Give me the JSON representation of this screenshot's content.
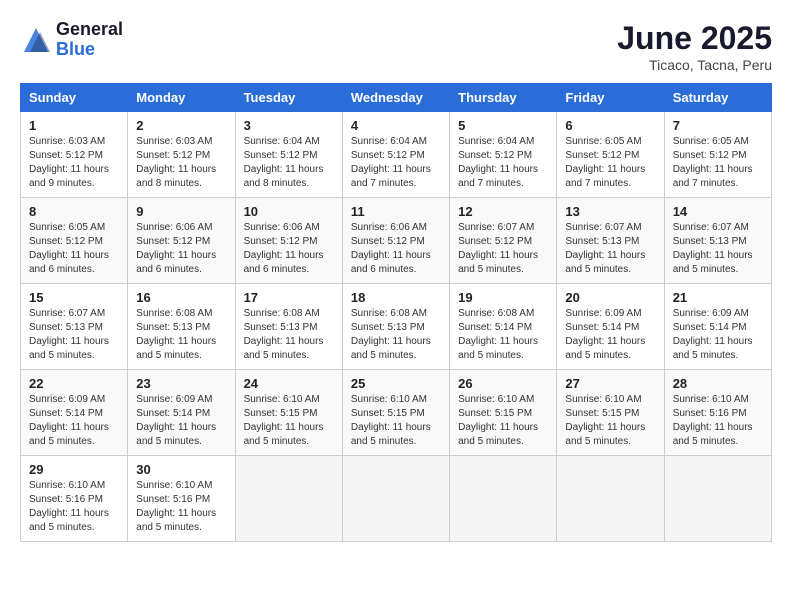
{
  "logo": {
    "general": "General",
    "blue": "Blue"
  },
  "title": "June 2025",
  "location": "Ticaco, Tacna, Peru",
  "weekdays": [
    "Sunday",
    "Monday",
    "Tuesday",
    "Wednesday",
    "Thursday",
    "Friday",
    "Saturday"
  ],
  "weeks": [
    [
      {
        "day": "1",
        "sunrise": "Sunrise: 6:03 AM",
        "sunset": "Sunset: 5:12 PM",
        "daylight": "Daylight: 11 hours and 9 minutes."
      },
      {
        "day": "2",
        "sunrise": "Sunrise: 6:03 AM",
        "sunset": "Sunset: 5:12 PM",
        "daylight": "Daylight: 11 hours and 8 minutes."
      },
      {
        "day": "3",
        "sunrise": "Sunrise: 6:04 AM",
        "sunset": "Sunset: 5:12 PM",
        "daylight": "Daylight: 11 hours and 8 minutes."
      },
      {
        "day": "4",
        "sunrise": "Sunrise: 6:04 AM",
        "sunset": "Sunset: 5:12 PM",
        "daylight": "Daylight: 11 hours and 7 minutes."
      },
      {
        "day": "5",
        "sunrise": "Sunrise: 6:04 AM",
        "sunset": "Sunset: 5:12 PM",
        "daylight": "Daylight: 11 hours and 7 minutes."
      },
      {
        "day": "6",
        "sunrise": "Sunrise: 6:05 AM",
        "sunset": "Sunset: 5:12 PM",
        "daylight": "Daylight: 11 hours and 7 minutes."
      },
      {
        "day": "7",
        "sunrise": "Sunrise: 6:05 AM",
        "sunset": "Sunset: 5:12 PM",
        "daylight": "Daylight: 11 hours and 7 minutes."
      }
    ],
    [
      {
        "day": "8",
        "sunrise": "Sunrise: 6:05 AM",
        "sunset": "Sunset: 5:12 PM",
        "daylight": "Daylight: 11 hours and 6 minutes."
      },
      {
        "day": "9",
        "sunrise": "Sunrise: 6:06 AM",
        "sunset": "Sunset: 5:12 PM",
        "daylight": "Daylight: 11 hours and 6 minutes."
      },
      {
        "day": "10",
        "sunrise": "Sunrise: 6:06 AM",
        "sunset": "Sunset: 5:12 PM",
        "daylight": "Daylight: 11 hours and 6 minutes."
      },
      {
        "day": "11",
        "sunrise": "Sunrise: 6:06 AM",
        "sunset": "Sunset: 5:12 PM",
        "daylight": "Daylight: 11 hours and 6 minutes."
      },
      {
        "day": "12",
        "sunrise": "Sunrise: 6:07 AM",
        "sunset": "Sunset: 5:12 PM",
        "daylight": "Daylight: 11 hours and 5 minutes."
      },
      {
        "day": "13",
        "sunrise": "Sunrise: 6:07 AM",
        "sunset": "Sunset: 5:13 PM",
        "daylight": "Daylight: 11 hours and 5 minutes."
      },
      {
        "day": "14",
        "sunrise": "Sunrise: 6:07 AM",
        "sunset": "Sunset: 5:13 PM",
        "daylight": "Daylight: 11 hours and 5 minutes."
      }
    ],
    [
      {
        "day": "15",
        "sunrise": "Sunrise: 6:07 AM",
        "sunset": "Sunset: 5:13 PM",
        "daylight": "Daylight: 11 hours and 5 minutes."
      },
      {
        "day": "16",
        "sunrise": "Sunrise: 6:08 AM",
        "sunset": "Sunset: 5:13 PM",
        "daylight": "Daylight: 11 hours and 5 minutes."
      },
      {
        "day": "17",
        "sunrise": "Sunrise: 6:08 AM",
        "sunset": "Sunset: 5:13 PM",
        "daylight": "Daylight: 11 hours and 5 minutes."
      },
      {
        "day": "18",
        "sunrise": "Sunrise: 6:08 AM",
        "sunset": "Sunset: 5:13 PM",
        "daylight": "Daylight: 11 hours and 5 minutes."
      },
      {
        "day": "19",
        "sunrise": "Sunrise: 6:08 AM",
        "sunset": "Sunset: 5:14 PM",
        "daylight": "Daylight: 11 hours and 5 minutes."
      },
      {
        "day": "20",
        "sunrise": "Sunrise: 6:09 AM",
        "sunset": "Sunset: 5:14 PM",
        "daylight": "Daylight: 11 hours and 5 minutes."
      },
      {
        "day": "21",
        "sunrise": "Sunrise: 6:09 AM",
        "sunset": "Sunset: 5:14 PM",
        "daylight": "Daylight: 11 hours and 5 minutes."
      }
    ],
    [
      {
        "day": "22",
        "sunrise": "Sunrise: 6:09 AM",
        "sunset": "Sunset: 5:14 PM",
        "daylight": "Daylight: 11 hours and 5 minutes."
      },
      {
        "day": "23",
        "sunrise": "Sunrise: 6:09 AM",
        "sunset": "Sunset: 5:14 PM",
        "daylight": "Daylight: 11 hours and 5 minutes."
      },
      {
        "day": "24",
        "sunrise": "Sunrise: 6:10 AM",
        "sunset": "Sunset: 5:15 PM",
        "daylight": "Daylight: 11 hours and 5 minutes."
      },
      {
        "day": "25",
        "sunrise": "Sunrise: 6:10 AM",
        "sunset": "Sunset: 5:15 PM",
        "daylight": "Daylight: 11 hours and 5 minutes."
      },
      {
        "day": "26",
        "sunrise": "Sunrise: 6:10 AM",
        "sunset": "Sunset: 5:15 PM",
        "daylight": "Daylight: 11 hours and 5 minutes."
      },
      {
        "day": "27",
        "sunrise": "Sunrise: 6:10 AM",
        "sunset": "Sunset: 5:15 PM",
        "daylight": "Daylight: 11 hours and 5 minutes."
      },
      {
        "day": "28",
        "sunrise": "Sunrise: 6:10 AM",
        "sunset": "Sunset: 5:16 PM",
        "daylight": "Daylight: 11 hours and 5 minutes."
      }
    ],
    [
      {
        "day": "29",
        "sunrise": "Sunrise: 6:10 AM",
        "sunset": "Sunset: 5:16 PM",
        "daylight": "Daylight: 11 hours and 5 minutes."
      },
      {
        "day": "30",
        "sunrise": "Sunrise: 6:10 AM",
        "sunset": "Sunset: 5:16 PM",
        "daylight": "Daylight: 11 hours and 5 minutes."
      },
      null,
      null,
      null,
      null,
      null
    ]
  ]
}
